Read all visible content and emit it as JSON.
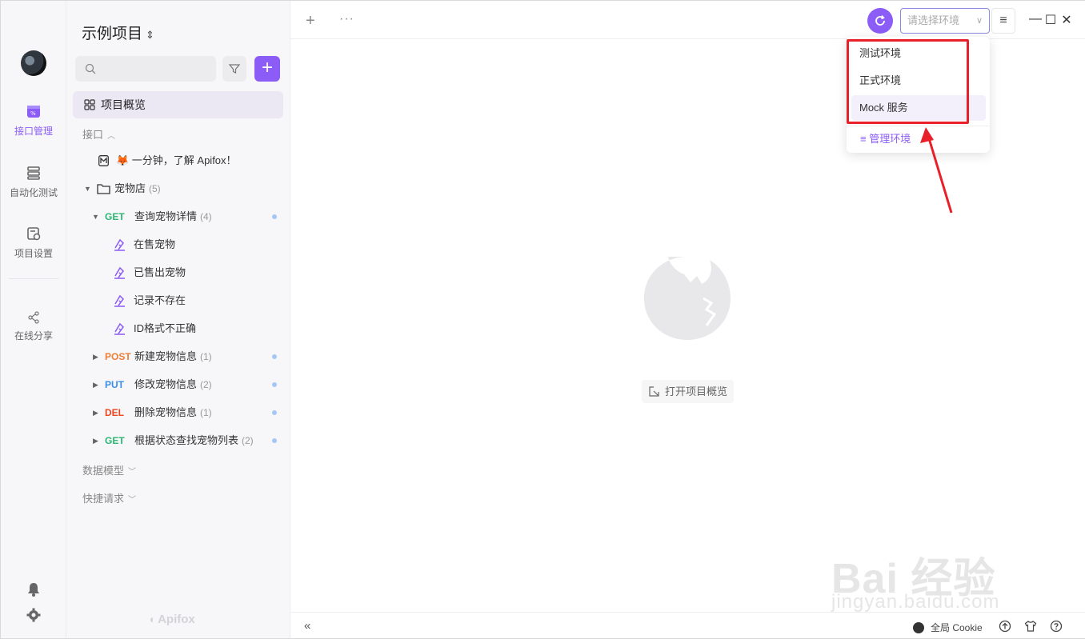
{
  "rail": {
    "items": [
      {
        "label": "接口管理",
        "icon": "api-icon"
      },
      {
        "label": "自动化测试",
        "icon": "test-icon"
      },
      {
        "label": "项目设置",
        "icon": "settings-icon"
      },
      {
        "label": "在线分享",
        "icon": "share-icon"
      }
    ]
  },
  "sidebar": {
    "project_title": "示例项目",
    "overview_label": "项目概览",
    "sections": {
      "api": "接口",
      "models": "数据模型",
      "quick": "快捷请求"
    },
    "intro_doc": "🦊 一分钟，了解 Apifox！",
    "folder": {
      "name": "宠物店",
      "count": "(5)"
    },
    "endpoints": [
      {
        "method": "GET",
        "name": "查询宠物详情",
        "count": "(4)"
      },
      {
        "method": "POST",
        "name": "新建宠物信息",
        "count": "(1)"
      },
      {
        "method": "PUT",
        "name": "修改宠物信息",
        "count": "(2)"
      },
      {
        "method": "DEL",
        "name": "删除宠物信息",
        "count": "(1)"
      },
      {
        "method": "GET",
        "name": "根据状态查找宠物列表",
        "count": "(2)"
      }
    ],
    "cases": [
      "在售宠物",
      "已售出宠物",
      "记录不存在",
      "ID格式不正确"
    ],
    "brand": "Apifox"
  },
  "topbar": {
    "env_placeholder": "请选择环境"
  },
  "env_dropdown": {
    "options": [
      "测试环境",
      "正式环境",
      "Mock 服务"
    ],
    "manage_label": "管理环境"
  },
  "main": {
    "open_overview_label": "打开项目概览"
  },
  "bottombar": {
    "cookie_label": "全局 Cookie"
  },
  "watermark": {
    "line1": "Bai 经验",
    "line2": "jingyan.baidu.com"
  },
  "colors": {
    "accent": "#8b5cf6",
    "highlight_box": "#e8202a",
    "get": "#2bb673",
    "post": "#ee7e35",
    "put": "#3a8ee6",
    "del": "#e8461f"
  }
}
